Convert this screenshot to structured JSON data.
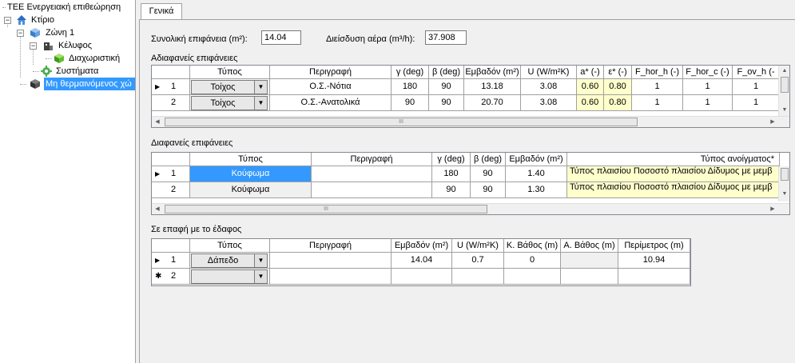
{
  "tree": {
    "root": "ΤΕΕ Ενεργειακή επιθεώρηση",
    "building": "Κτίριο",
    "zone": "Ζώνη 1",
    "envelope": "Κέλυφος",
    "partition": "Διαχωριστική",
    "systems": "Συστήματα",
    "unheated": "Μη θερμαινόμενος χώ"
  },
  "tabs": {
    "general": "Γενικά"
  },
  "form": {
    "total_area_label": "Συνολική επιφάνεια (m²):",
    "total_area_value": "14.04",
    "air_infiltration_label": "Διείσδυση αέρα (m³/h):",
    "air_infiltration_value": "37.908"
  },
  "opaque": {
    "title": "Αδιαφανείς επιφάνειες",
    "headers": [
      "Τύπος",
      "Περιγραφή",
      "γ (deg)",
      "β (deg)",
      "Εμβαδόν (m²)",
      "U (W/m²K)",
      "a* (-)",
      "ε* (-)",
      "F_hor_h (-)",
      "F_hor_c (-)",
      "F_ov_h (-"
    ],
    "rows": [
      {
        "num": "1",
        "type": "Τοίχος",
        "desc": "Ο.Σ.-Νότια",
        "gamma": "180",
        "beta": "90",
        "area": "13.18",
        "u": "3.08",
        "a": "0.60",
        "e": "0.80",
        "fhh": "1",
        "fhc": "1",
        "foh": "1"
      },
      {
        "num": "2",
        "type": "Τοίχος",
        "desc": "Ο.Σ.-Ανατολικά",
        "gamma": "90",
        "beta": "90",
        "area": "20.70",
        "u": "3.08",
        "a": "0.60",
        "e": "0.80",
        "fhh": "1",
        "fhc": "1",
        "foh": "1"
      }
    ]
  },
  "transparent": {
    "title": "Διαφανείς επιφάνειες",
    "headers": [
      "Τύπος",
      "Περιγραφή",
      "γ (deg)",
      "β (deg)",
      "Εμβαδόν (m²)",
      "Τύπος ανοίγματος*"
    ],
    "rows": [
      {
        "num": "1",
        "type": "Κούφωμα",
        "desc": "",
        "gamma": "180",
        "beta": "90",
        "area": "1.40",
        "opening": "Τύπος πλαισίου Ποσοστό πλαισίου Δίδυμος με μεμβ"
      },
      {
        "num": "2",
        "type": "Κούφωμα",
        "desc": "",
        "gamma": "90",
        "beta": "90",
        "area": "1.30",
        "opening": "Τύπος πλαισίου Ποσοστό πλαισίου Δίδυμος με μεμβ"
      }
    ]
  },
  "ground": {
    "title": "Σε επαφή με το έδαφος",
    "headers": [
      "Τύπος",
      "Περιγραφή",
      "Εμβαδόν (m²)",
      "U (W/m²K)",
      "Κ. Βάθος (m)",
      "Α. Βάθος (m)",
      "Περίμετρος (m)"
    ],
    "rows": [
      {
        "num": "1",
        "type": "Δάπεδο",
        "desc": "",
        "area": "14.04",
        "u": "0.7",
        "kdepth": "0",
        "adepth": "",
        "perimeter": "10.94"
      },
      {
        "num": "2",
        "type": "",
        "desc": "",
        "area": "",
        "u": "",
        "kdepth": "",
        "adepth": "",
        "perimeter": ""
      }
    ]
  },
  "glyphs": {
    "current_row": "▶",
    "new_row": "✱",
    "dropdown": "▼",
    "scroll_left": "◀",
    "scroll_right": "▶",
    "scroll_up": "▲",
    "scroll_down": "▼",
    "grip": "III",
    "expanded": "−"
  },
  "colors": {
    "selection": "#3399ff",
    "highlight_cell": "#ffffcc"
  }
}
